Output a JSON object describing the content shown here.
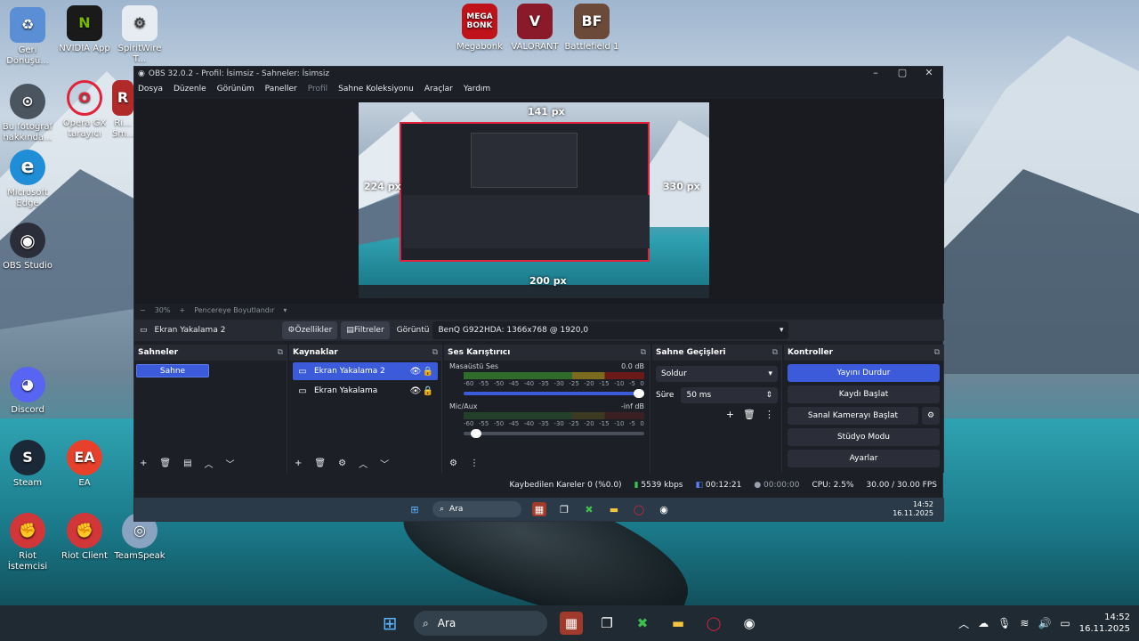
{
  "desktop": {
    "icons": [
      {
        "label": "Geri Dönüşü...",
        "glyph": "♻",
        "color": "#5a8fd6"
      },
      {
        "label": "NVIDIA App",
        "glyph": "N",
        "color": "#76b900"
      },
      {
        "label": "SpiritWire T...",
        "glyph": "⚙",
        "color": "#d0d8e0"
      },
      {
        "label": "Megabonk",
        "glyph": "MEGA BONK",
        "color": "#c0121b"
      },
      {
        "label": "VALORANT",
        "glyph": "V",
        "color": "#c8263b"
      },
      {
        "label": "Battlefield 1",
        "glyph": "BF",
        "color": "#6b4a3a"
      },
      {
        "label": "Bu fotoğraf hakkında...",
        "glyph": "⊙",
        "color": "#4b5560"
      },
      {
        "label": "Opera GX tarayıcı",
        "glyph": "O",
        "color": "#e0233b"
      },
      {
        "label": "Ri... Sm...",
        "glyph": "R",
        "color": "#b02a2a"
      },
      {
        "label": "Microsoft Edge",
        "glyph": "e",
        "color": "#1f8ed6"
      },
      {
        "label": "OBS Studio",
        "glyph": "◉",
        "color": "#2b2e38"
      },
      {
        "label": "Discord",
        "glyph": "◕",
        "color": "#5865f2"
      },
      {
        "label": "Steam",
        "glyph": "S",
        "color": "#1b2838"
      },
      {
        "label": "EA",
        "glyph": "EA",
        "color": "#e8412b"
      },
      {
        "label": "Riot İstemcisi",
        "glyph": "✊",
        "color": "#d13639"
      },
      {
        "label": "Riot Client",
        "glyph": "✊",
        "color": "#d13639"
      },
      {
        "label": "TeamSpeak",
        "glyph": "◎",
        "color": "#8aa3c0"
      }
    ]
  },
  "obs": {
    "title": "OBS 32.0.2 - Profil: İsimsiz - Sahneler: İsimsiz",
    "menu": [
      "Dosya",
      "Düzenle",
      "Görünüm",
      "Paneller",
      "Profil",
      "Sahne Koleksiyonu",
      "Araçlar",
      "Yardım"
    ],
    "crop_labels": {
      "top": "141 px",
      "left": "224 px",
      "right": "330 px",
      "bottom": "200 px"
    },
    "zoom": {
      "minus": "−",
      "value": "30%",
      "plus": "+",
      "fit": "Pencereye Boyutlandır"
    },
    "source_bar": {
      "name": "Ekran Yakalama 2",
      "properties": "Özellikler",
      "filters": "Filtreler",
      "display_label": "Görüntü",
      "display_value": "BenQ G922HDA: 1366x768 @ 1920,0"
    },
    "scenes": {
      "title": "Sahneler",
      "items": [
        "Sahne"
      ]
    },
    "sources": {
      "title": "Kaynaklar",
      "items": [
        "Ekran Yakalama 2",
        "Ekran Yakalama"
      ]
    },
    "mixer": {
      "title": "Ses Karıştırıcı",
      "channels": [
        {
          "name": "Masaüstü Ses",
          "level": "0.0 dB"
        },
        {
          "name": "Mic/Aux",
          "level": "-inf dB"
        }
      ],
      "scale": [
        "-60",
        "-55",
        "-50",
        "-45",
        "-40",
        "-35",
        "-30",
        "-25",
        "-20",
        "-15",
        "-10",
        "-5",
        "0"
      ]
    },
    "transitions": {
      "title": "Sahne Geçişleri",
      "type": "Soldur",
      "duration_label": "Süre",
      "duration": "50 ms"
    },
    "controls": {
      "title": "Kontroller",
      "buttons": [
        "Yayını Durdur",
        "Kaydı Başlat",
        "Sanal Kamerayı Başlat",
        "Stüdyo Modu",
        "Ayarlar"
      ]
    },
    "status": {
      "dropped": "Kaybedilen Kareler 0 (%0.0)",
      "bitrate": "5539 kbps",
      "stream_time": "00:12:21",
      "rec_time": "00:00:00",
      "cpu": "CPU: 2.5%",
      "fps": "30.00 / 30.00 FPS"
    }
  },
  "taskbar": {
    "search": "Ara",
    "time": "14:52",
    "date": "16.11.2025"
  }
}
